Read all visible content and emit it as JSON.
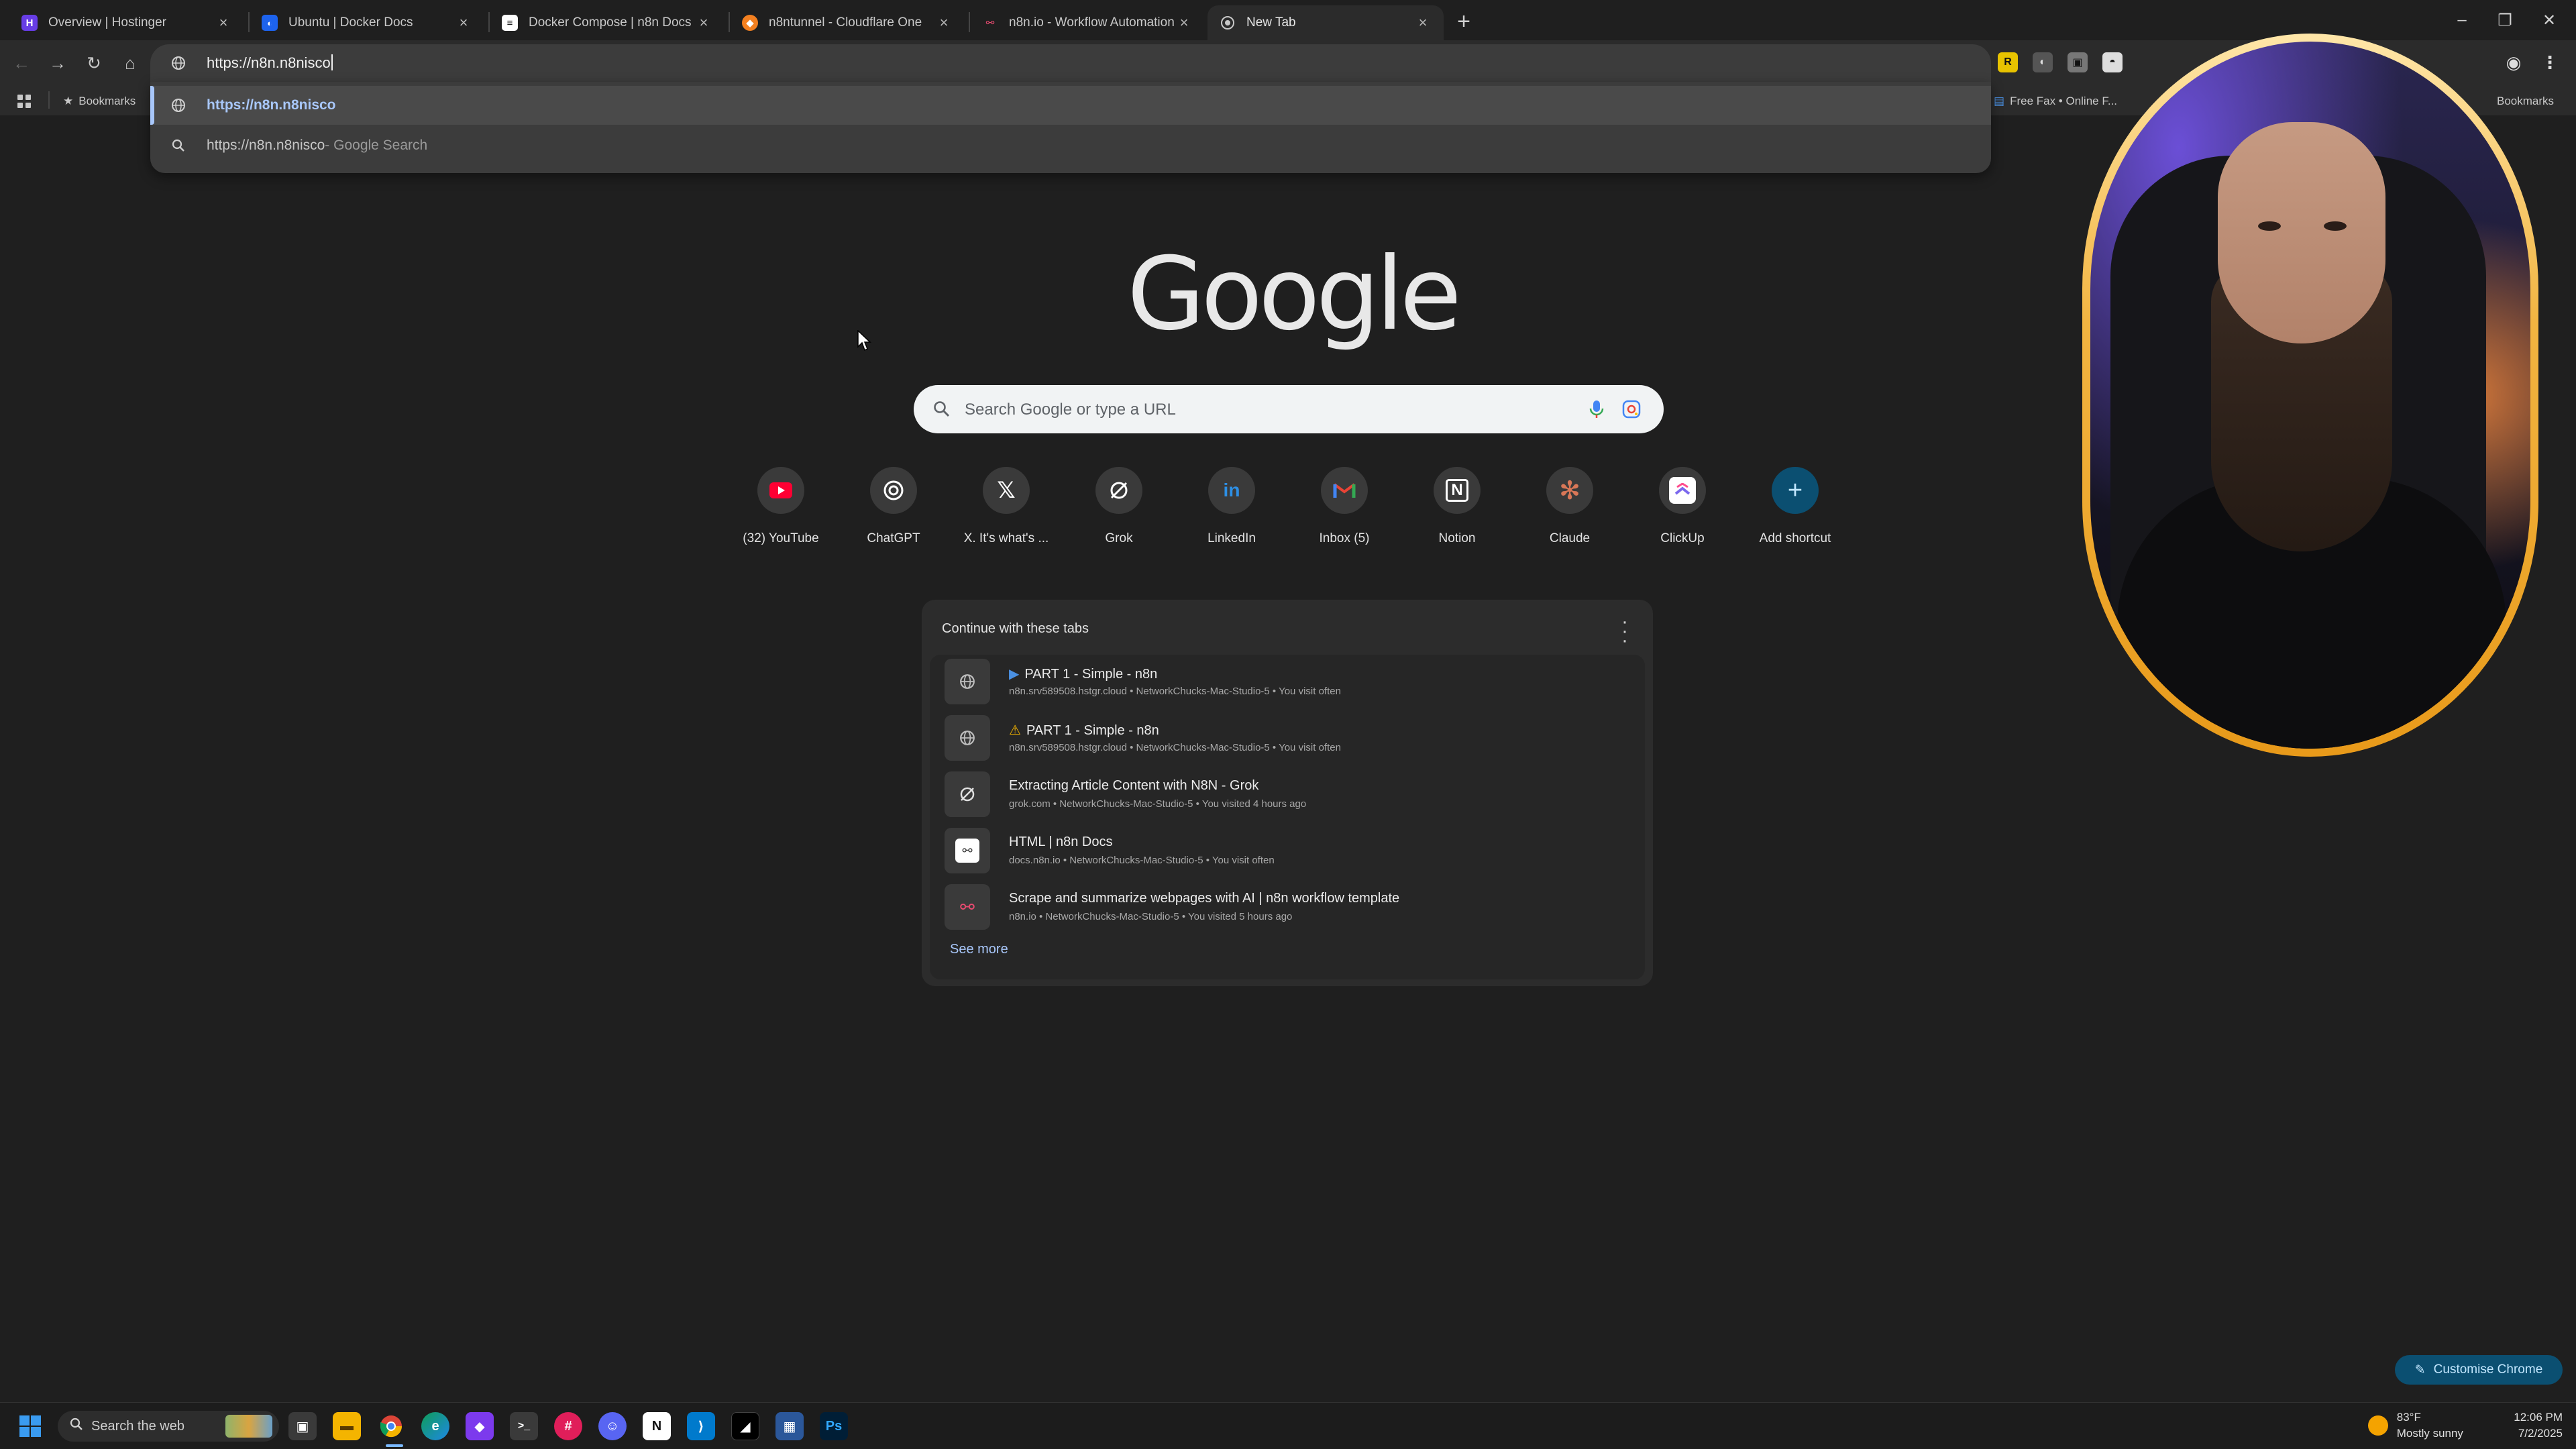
{
  "tabs": [
    {
      "label": "Overview | Hostinger",
      "fav_color": "#673de6",
      "fav_glyph": "H"
    },
    {
      "label": "Ubuntu | Docker Docs",
      "fav_color": "#1d63ed",
      "fav_glyph": "🐳"
    },
    {
      "label": "Docker Compose | n8n Docs",
      "fav_color": "#ffffff",
      "fav_glyph": "≡"
    },
    {
      "label": "n8ntunnel - Cloudflare One",
      "fav_color": "#f38020",
      "fav_glyph": "◆"
    },
    {
      "label": "n8n.io - Workflow Automation",
      "fav_color": "#ea4b71",
      "fav_glyph": "∞"
    },
    {
      "label": "New Tab",
      "fav_color": "#444444",
      "fav_glyph": "◎"
    }
  ],
  "omnibox": {
    "value": "https://n8n.n8nisco"
  },
  "suggestions": [
    {
      "text": "https://n8n.n8nisco"
    },
    {
      "text": "https://n8n.n8nisco",
      "suffix": " - Google Search"
    }
  ],
  "bookmarks": {
    "label": "Bookmarks",
    "right_item": "Free Fax • Online F...",
    "all_label": "Bookmarks"
  },
  "ntp": {
    "logo": "Google",
    "search_placeholder": "Search Google or type a URL",
    "shortcuts": [
      {
        "label": "(32) YouTube",
        "icon": "youtube-icon",
        "color": "#ff0033"
      },
      {
        "label": "ChatGPT",
        "icon": "chatgpt-icon",
        "color": "#ffffff"
      },
      {
        "label": "X. It's what's ...",
        "icon": "x-icon",
        "color": "#ffffff"
      },
      {
        "label": "Grok",
        "icon": "grok-icon",
        "color": "#ffffff"
      },
      {
        "label": "LinkedIn",
        "icon": "linkedin-icon",
        "color": "#0a66c2"
      },
      {
        "label": "Inbox (5)",
        "icon": "gmail-icon",
        "color": "#ea4335"
      },
      {
        "label": "Notion",
        "icon": "notion-icon",
        "color": "#ffffff"
      },
      {
        "label": "Claude",
        "icon": "claude-icon",
        "color": "#d97757"
      },
      {
        "label": "ClickUp",
        "icon": "clickup-icon",
        "color": "#7b68ee"
      },
      {
        "label": "Add shortcut",
        "icon": "plus-icon",
        "color": "#0b4f71"
      }
    ]
  },
  "continue_card": {
    "title": "Continue with these tabs",
    "see_more": "See more",
    "items": [
      {
        "title": "PART 1 - Simple - n8n",
        "badge": "▶",
        "sub": "n8n.srv589508.hstgr.cloud • NetworkChucks-Mac-Studio-5 • You visit often",
        "icon": "globe-icon"
      },
      {
        "title": "PART 1 - Simple - n8n",
        "badge": "⚠",
        "sub": "n8n.srv589508.hstgr.cloud • NetworkChucks-Mac-Studio-5 • You visit often",
        "icon": "globe-icon"
      },
      {
        "title": "Extracting Article Content with N8N - Grok",
        "badge": "",
        "sub": "grok.com • NetworkChucks-Mac-Studio-5 • You visited 4 hours ago",
        "icon": "grok-icon"
      },
      {
        "title": "HTML | n8n Docs",
        "badge": "",
        "sub": "docs.n8n.io • NetworkChucks-Mac-Studio-5 • You visit often",
        "icon": "n8n-docs-icon"
      },
      {
        "title": "Scrape and summarize webpages with AI | n8n workflow template",
        "badge": "",
        "sub": "n8n.io • NetworkChucks-Mac-Studio-5 • You visited 5 hours ago",
        "icon": "n8n-icon"
      }
    ]
  },
  "customise_label": "Customise Chrome",
  "taskbar": {
    "search_label": "Search the web",
    "weather_temp": "83°F",
    "weather_desc": "Mostly sunny",
    "time": "12:06 PM",
    "date": "7/2/2025",
    "apps": [
      {
        "name": "task-view",
        "color": "#3a3a3a",
        "glyph": "▣"
      },
      {
        "name": "file-explorer",
        "color": "#f4b400",
        "glyph": "▬"
      },
      {
        "name": "chrome",
        "color": "#db4437",
        "glyph": "◉"
      },
      {
        "name": "edge",
        "color": "#0f9d58",
        "glyph": "e"
      },
      {
        "name": "obsidian",
        "color": "#7c3aed",
        "glyph": "◆"
      },
      {
        "name": "terminal",
        "color": "#3a3a3a",
        "glyph": ">_"
      },
      {
        "name": "slack",
        "color": "#e01e5a",
        "glyph": "#"
      },
      {
        "name": "discord",
        "color": "#5865f2",
        "glyph": "☺"
      },
      {
        "name": "notion",
        "color": "#ffffff",
        "glyph": "N"
      },
      {
        "name": "vscode",
        "color": "#007acc",
        "glyph": "⟩"
      },
      {
        "name": "app-dark",
        "color": "#000000",
        "glyph": "◢"
      },
      {
        "name": "app-grid",
        "color": "#2b579a",
        "glyph": "▦"
      },
      {
        "name": "photoshop",
        "color": "#001e36",
        "glyph": "Ps"
      }
    ]
  },
  "colors": {
    "accent_blue": "#a8c7fa",
    "cam_ring": "#f2b441"
  }
}
